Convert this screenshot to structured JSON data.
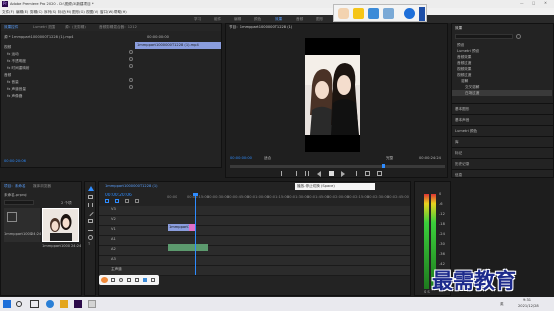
{
  "app": {
    "title": "Adobe Premiere Pro 2020 - D:\\视频\\3\\新建项目 *"
  },
  "window_controls": {
    "minimize": "—",
    "maximize": "□",
    "close": "✕"
  },
  "menu": [
    "文件(F)",
    "编辑(E)",
    "剪辑(C)",
    "序列(S)",
    "标记(M)",
    "图形(G)",
    "视图(V)",
    "窗口(W)",
    "帮助(H)"
  ],
  "workspaces": [
    "学习",
    "组件",
    "编辑",
    "颜色",
    "效果",
    "音频",
    "图形",
    "库"
  ],
  "active_workspace": "效果",
  "effects_panel": {
    "tabs": [
      "效果控件",
      "Lumetri 范围",
      "源：(无剪辑)",
      "音频剪辑混合器：1212"
    ],
    "path": "源 * 1mmppart1000000T1228 (1).mp4",
    "header_value": "00:00:00:00",
    "sections": [
      "视频",
      "fx 运动",
      "fx 不透明度",
      "fx 时间重映射",
      "音频",
      "fx 音量",
      "fx 声道音量",
      "fx 声像器"
    ]
  },
  "mini_clip": {
    "label": "1mmppart1000000T1228 (1).mp4",
    "time": "00:00:20:06"
  },
  "program": {
    "title": "节目：1mmppart1000000T1228 (1)",
    "timecode": "00:00:00:00",
    "fit": "适合",
    "quality": "完整",
    "duration": "00:00:24:24"
  },
  "right_panel": {
    "title": "效果",
    "items": [
      "预设",
      "Lumetri 预设",
      "音频效果",
      "音频过渡",
      "视频效果",
      "视频过渡",
      "溶解",
      "交叉溶解",
      "白场过渡"
    ],
    "sections": [
      "基本图形",
      "基本声音",
      "Lumetri 颜色",
      "库",
      "标记",
      "历史记录",
      "信息"
    ]
  },
  "project": {
    "tabs": [
      "项目：未命名",
      "媒体浏览器"
    ],
    "file": "未命名.prproj",
    "count": "2 个项",
    "items": [
      {
        "name": "1mmppart1000000T1228 (1)",
        "duration": "24:24"
      },
      {
        "name": "1mmppart1000000T1228 (1).mp4",
        "duration": "24:24"
      }
    ]
  },
  "timeline": {
    "tab": "1mmppart1000000T1228 (1)",
    "timecode": "00:00:20:06",
    "ruler": [
      "00:00",
      "00:00:15:00",
      "00:00:30:00",
      "00:00:45:00",
      "00:01:00:00",
      "00:01:15:00",
      "00:01:30:00",
      "00:01:45:00",
      "00:02:00:00",
      "00:02:15:00",
      "00:02:30:00",
      "00:02:45:00"
    ],
    "tracks": [
      "V3",
      "V2",
      "V1",
      "A1",
      "A2",
      "A3"
    ],
    "master": "主声道",
    "video_clip": "1mmppart1000000T1228 (1).mp4",
    "tooltip": "播放-停止切换 (Space)"
  },
  "meter": {
    "scale": [
      "0",
      "-6",
      "-12",
      "-18",
      "-24",
      "-30",
      "-36",
      "-42",
      "-48",
      "-54"
    ],
    "solo": "S S"
  },
  "taskbar": {
    "time": "9:31",
    "date": "2021/12/28",
    "lang": "英"
  },
  "watermark": "最需教育"
}
